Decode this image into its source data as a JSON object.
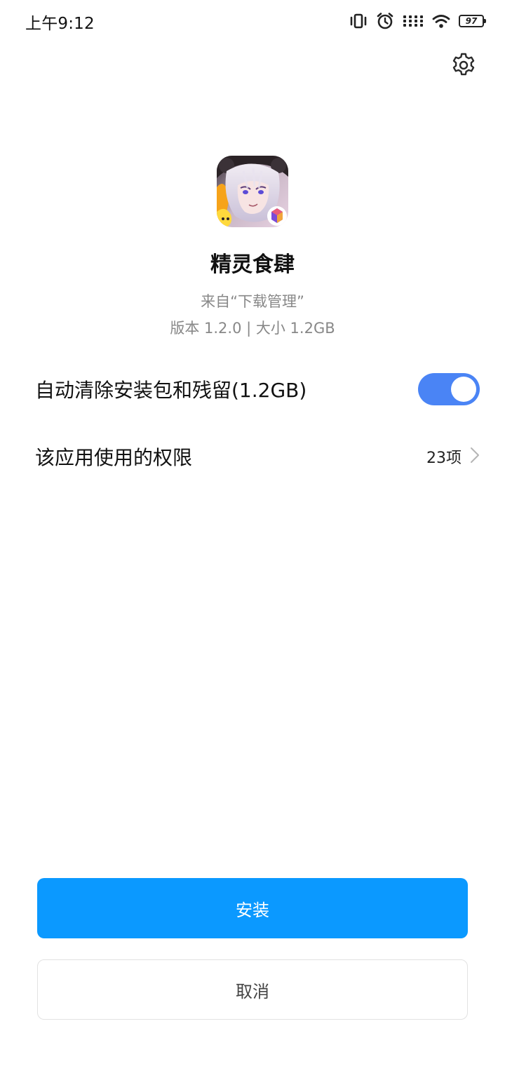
{
  "status_bar": {
    "time": "上午9:12",
    "battery_level": "97",
    "icons": [
      "vibrate-icon",
      "alarm-icon",
      "signal-icon",
      "wifi-icon",
      "battery-icon"
    ]
  },
  "header": {
    "settings_icon": "gear-icon"
  },
  "app": {
    "name": "精灵食肆",
    "source": "来自“下载管理”",
    "version_size": "版本 1.2.0 | 大小 1.2GB"
  },
  "options": {
    "auto_clean_label": "自动清除安装包和残留(1.2GB)",
    "auto_clean_enabled": true,
    "permissions_label": "该应用使用的权限",
    "permissions_count": "23项"
  },
  "actions": {
    "install_label": "安装",
    "cancel_label": "取消"
  },
  "colors": {
    "primary_button": "#0b99ff",
    "toggle_on": "#4a84f5"
  }
}
